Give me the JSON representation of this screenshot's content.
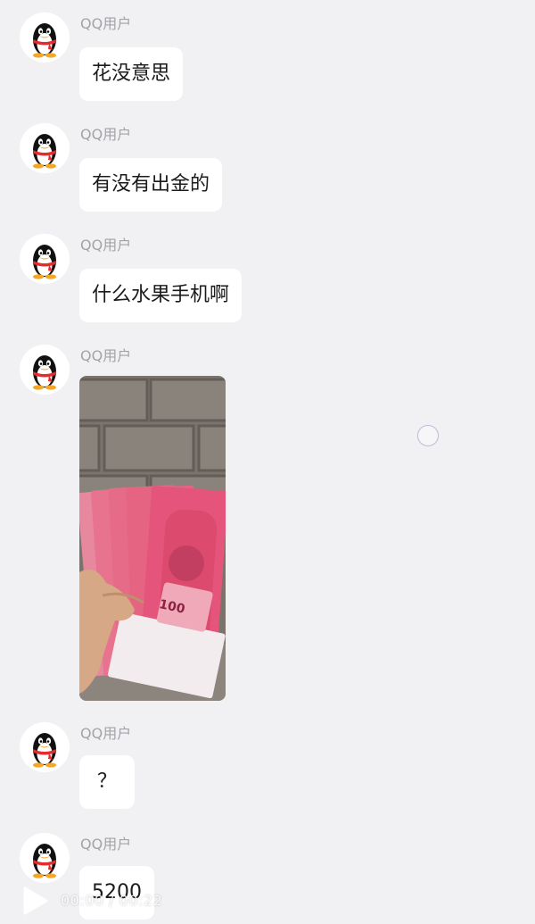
{
  "messages": [
    {
      "sender": "QQ用户",
      "text": "花没意思"
    },
    {
      "sender": "QQ用户",
      "text": "有没有出金的"
    },
    {
      "sender": "QQ用户",
      "text": "什么水果手机啊"
    },
    {
      "sender": "QQ用户",
      "image_banknote": "100"
    },
    {
      "sender": "QQ用户",
      "text": "？"
    },
    {
      "sender": "QQ用户",
      "text": "5200"
    }
  ],
  "player": {
    "time": "00:00 / 00:22",
    "play_icon": "play-icon"
  },
  "colors": {
    "background": "#f1f1f3",
    "bubble": "#ffffff",
    "sender": "#a3a3a8",
    "banknote": "#e5557b"
  }
}
